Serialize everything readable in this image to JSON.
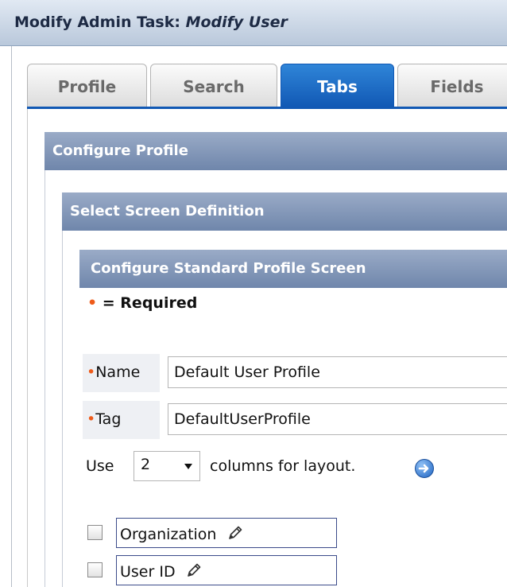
{
  "window": {
    "title_prefix": "Modify Admin Task: ",
    "title_italic": "Modify User"
  },
  "tabs": [
    {
      "label": "Profile",
      "active": false
    },
    {
      "label": "Search",
      "active": false
    },
    {
      "label": "Tabs",
      "active": true
    },
    {
      "label": "Fields",
      "active": false
    }
  ],
  "sections": {
    "configure_profile": "Configure Profile",
    "select_screen": "Select Screen Definition",
    "standard_screen": "Configure Standard Profile Screen"
  },
  "required_legend": {
    "marker": "•",
    "text": " = Required"
  },
  "form": {
    "name": {
      "marker": "•",
      "label": "Name",
      "value": "Default User Profile"
    },
    "tag": {
      "marker": "•",
      "label": "Tag",
      "value": "DefaultUserProfile"
    }
  },
  "layout": {
    "prefix": "Use",
    "columns": "2",
    "suffix": "columns for layout."
  },
  "fields": [
    {
      "label": "Organization",
      "icon": "pencil-icon"
    },
    {
      "label": "User ID",
      "icon": "pencil-icon"
    }
  ],
  "colors": {
    "accent": "#1158b4",
    "section_header": "#7d93b5",
    "required_dot": "#ee5b1a"
  }
}
